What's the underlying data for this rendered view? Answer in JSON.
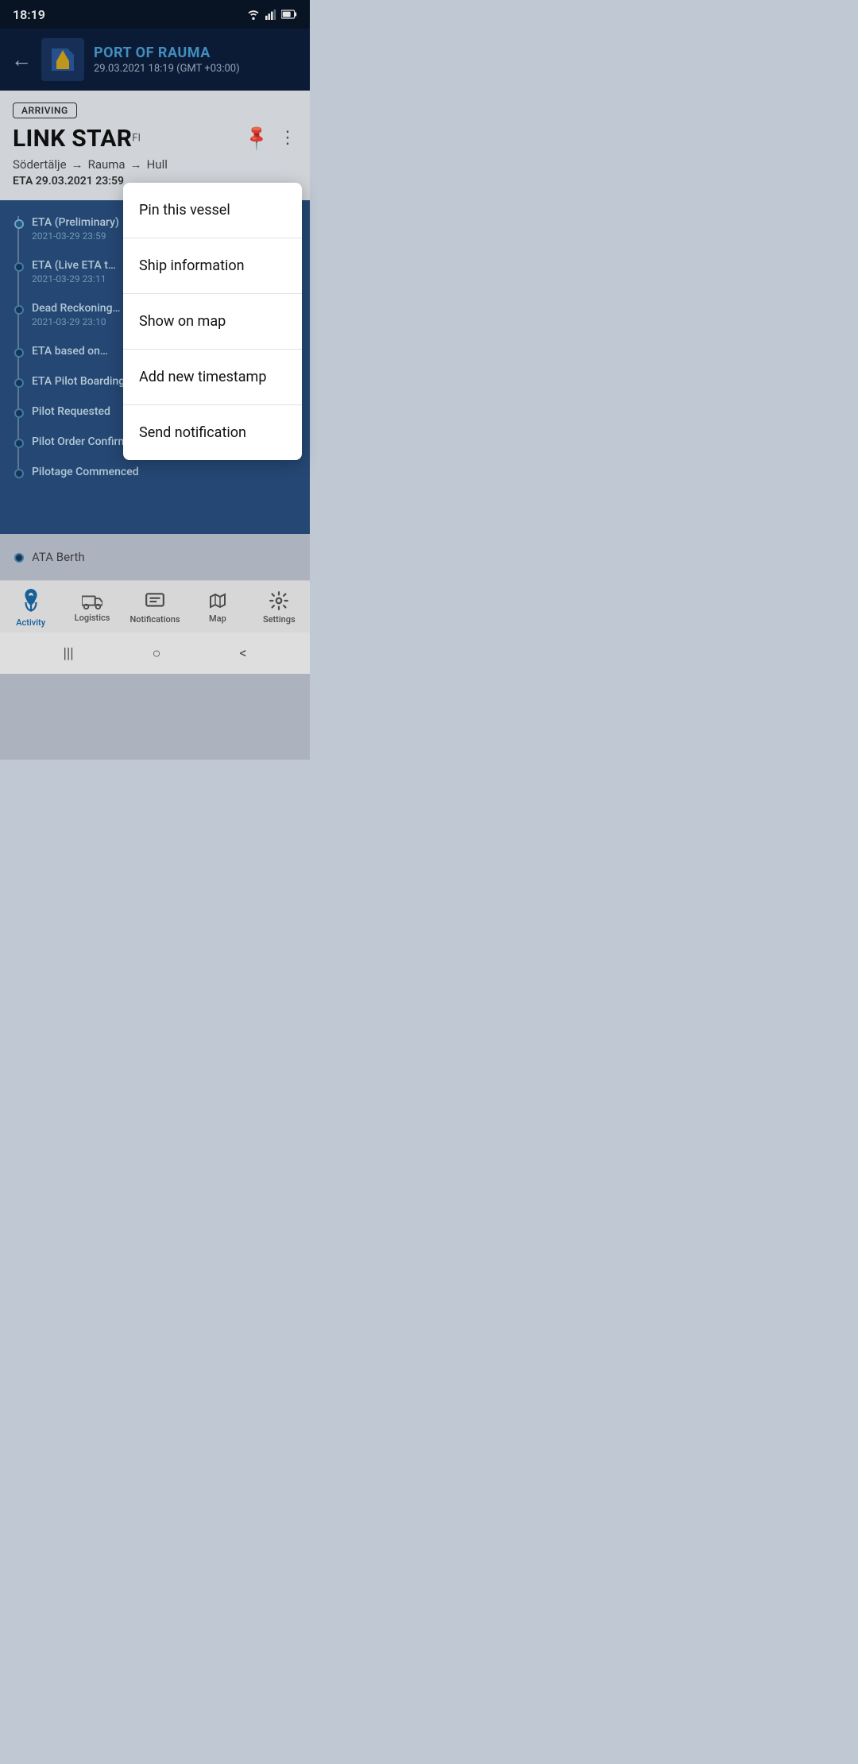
{
  "statusBar": {
    "time": "18:19"
  },
  "header": {
    "portName": "PORT OF RAUMA",
    "datetime": "29.03.2021 18:19 (GMT +03:00)"
  },
  "vessel": {
    "status": "ARRIVING",
    "name": "LINK STAR",
    "flag": "FI",
    "routeFrom": "Södertälje",
    "routeVia": "Rauma",
    "routeTo": "Hull",
    "eta": "ETA 29.03.2021 23:59"
  },
  "timeline": {
    "items": [
      {
        "label": "ETA (Preliminary)",
        "time": "2021-03-29 23:59"
      },
      {
        "label": "ETA (Live ETA t…",
        "time": "2021-03-29 23:11"
      },
      {
        "label": "Dead Reckoning…",
        "time": "2021-03-29 23:10"
      },
      {
        "label": "ETA based on…",
        "time": ""
      },
      {
        "label": "ETA Pilot Boarding Confirmed by Ship",
        "time": ""
      },
      {
        "label": "Pilot Requested",
        "time": ""
      },
      {
        "label": "Pilot Order Confirmed by Ship",
        "time": ""
      },
      {
        "label": "Pilotage Commenced",
        "time": ""
      }
    ]
  },
  "graySection": {
    "item": "ATA Berth"
  },
  "contextMenu": {
    "items": [
      "Pin this vessel",
      "Ship information",
      "Show on map",
      "Add new timestamp",
      "Send notification"
    ]
  },
  "bottomNav": {
    "items": [
      {
        "id": "activity",
        "label": "Activity",
        "icon": "⚓",
        "active": true
      },
      {
        "id": "logistics",
        "label": "Logistics",
        "icon": "🚚",
        "active": false
      },
      {
        "id": "notifications",
        "label": "Notifications",
        "icon": "💬",
        "active": false
      },
      {
        "id": "map",
        "label": "Map",
        "icon": "🗺",
        "active": false
      },
      {
        "id": "settings",
        "label": "Settings",
        "icon": "⚙",
        "active": false
      }
    ]
  },
  "androidNav": {
    "menu": "|||",
    "home": "○",
    "back": "<"
  }
}
